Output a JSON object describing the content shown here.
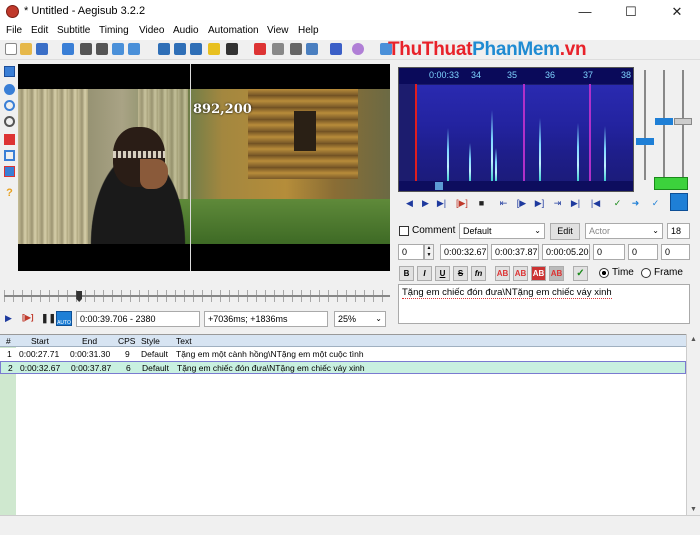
{
  "window": {
    "title": "* Untitled - Aegisub 3.2.2"
  },
  "watermark": {
    "part1": "Thu",
    "part2": "Thuat",
    "part3": "PhanMem",
    "part4": ".vn"
  },
  "menu": [
    "File",
    "Edit",
    "Subtitle",
    "Timing",
    "Video",
    "Audio",
    "Automation",
    "View",
    "Help"
  ],
  "video": {
    "coordinate_overlay": "892,200",
    "position": "0:00:39.706 - 2380",
    "offset": "+7036ms; +1836ms",
    "zoom": "25%",
    "seek_fraction": 0.19
  },
  "audio": {
    "ruler_labels": [
      "0:00:33",
      "34",
      "35",
      "36",
      "37",
      "38"
    ]
  },
  "editor": {
    "comment_label": "Comment",
    "style": "Default",
    "edit_button": "Edit",
    "actor_placeholder": "Actor",
    "margin_layer": "18",
    "layer": "0",
    "start_time": "0:00:32.67",
    "end_time": "0:00:37.87",
    "duration": "0:00:05.20",
    "margin_l": "0",
    "margin_r": "0",
    "margin_v": "0",
    "format_buttons": [
      "B",
      "I",
      "U",
      "S",
      "fn",
      "AB",
      "AB",
      "AB",
      "AB"
    ],
    "time_label": "Time",
    "frame_label": "Frame",
    "time_mode_selected": "Time",
    "text": "Tặng em chiếc đón đưa\\NTặng em chiếc váy xinh"
  },
  "grid": {
    "columns": [
      "#",
      "Start",
      "End",
      "CPS",
      "Style",
      "Text"
    ],
    "rows": [
      {
        "num": "1",
        "start": "0:00:27.71",
        "end": "0:00:31.30",
        "cps": "9",
        "style": "Default",
        "text": "Tặng em một cành hồng\\NTặng em một cuộc tình"
      },
      {
        "num": "2",
        "start": "0:00:32.67",
        "end": "0:00:37.87",
        "cps": "6",
        "style": "Default",
        "text": "Tặng em chiếc đón đưa\\NTặng em chiếc váy xinh"
      }
    ]
  },
  "colors": {
    "accent": "#1e7fd6",
    "selected_row": "#c8f0e0",
    "grid_header": "#d7e4f2"
  }
}
